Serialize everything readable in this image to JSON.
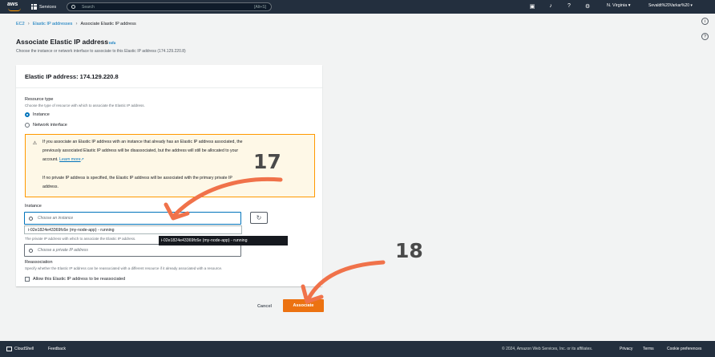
{
  "topnav": {
    "logo": "aws",
    "services_label": "Services",
    "search_placeholder": "Search",
    "search_hint": "[Alt+S]",
    "icons": [
      "cloudshell-icon",
      "bell-icon",
      "help-icon",
      "settings-icon"
    ],
    "region": "N. Virginia ▾",
    "account": "Sevaldt%20Varkar%20 ▾"
  },
  "breadcrumb": {
    "root": "EC2",
    "parent": "Elastic IP addresses",
    "current": "Associate Elastic IP address"
  },
  "page": {
    "title": "Associate Elastic IP address",
    "info": "Info",
    "description": "Choose the instance or network interface to associate to this Elastic IP address (174.129.220.8)"
  },
  "card": {
    "header": "Elastic IP address: 174.129.220.8",
    "resource_type": {
      "label": "Resource type",
      "description": "Choose the type of resource with which to associate the Elastic IP address.",
      "options": [
        {
          "label": "Instance",
          "selected": true
        },
        {
          "label": "Network interface",
          "selected": false
        }
      ]
    },
    "alert": {
      "line1": "If you associate an Elastic IP address with an instance that already has an Elastic IP address associated, the",
      "line2": "previously associated Elastic IP address will be disassociated, but the address will still be allocated to your",
      "line3": "account.",
      "learn_more": "Learn more",
      "line4": "If no private IP address is specified, the Elastic IP address will be associated with the primary private IP",
      "line5": "address."
    },
    "instance": {
      "label": "Instance",
      "placeholder": "Choose an instance",
      "dropdown_option": "i-02e1824e43369fc6e (my-node-app) - running",
      "tooltip": "i-02e1824e43369fc6e (my-node-app) - running"
    },
    "private_ip": {
      "description": "The private IP address with which to associate the Elastic IP address.",
      "placeholder": "Choose a private IP address"
    },
    "reassociation": {
      "label": "Reassociation",
      "description": "Specify whether the Elastic IP address can be reassociated with a different resource if it already associated with a resource.",
      "checkbox_label": "Allow this Elastic IP address to be reassociated",
      "checked": false
    }
  },
  "actions": {
    "cancel": "Cancel",
    "associate": "Associate"
  },
  "annotations": {
    "step1": "17",
    "step2": "18",
    "arrow_color": "#f0724a"
  },
  "footer": {
    "cloudshell": "CloudShell",
    "feedback": "Feedback",
    "copyright": "© 2024, Amazon Web Services, Inc. or its affiliates.",
    "privacy": "Privacy",
    "terms": "Terms",
    "cookies": "Cookie preferences"
  },
  "colors": {
    "nav_bg": "#232f3e",
    "link": "#0073bb",
    "primary_button": "#ec7211",
    "alert_bg": "#fef8e7",
    "alert_border": "#ff9900"
  }
}
